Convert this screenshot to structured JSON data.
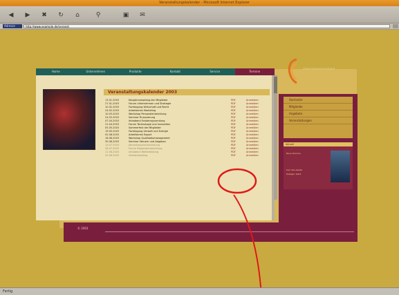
{
  "window": {
    "title": "Veranstaltungskalender - Microsoft Internet Explorer"
  },
  "toolbar": {
    "icons": [
      "back-icon",
      "forward-icon",
      "stop-icon",
      "refresh-icon",
      "home-icon",
      "search-icon",
      "print-icon",
      "mail-icon"
    ]
  },
  "address": {
    "label": "Adresse",
    "value": "http://www.example.de/veranst"
  },
  "nav": {
    "items": [
      "Home",
      "Unternehmen",
      "Produkte",
      "Kontakt",
      "Service",
      "Termine"
    ]
  },
  "content": {
    "heading": "Veranstaltungskalender 2003",
    "rows": [
      {
        "date": "13.01.2003",
        "name": "Neujahrsempfang der Mitglieder",
        "format": "PDF",
        "action": "Anmelden"
      },
      {
        "date": "27.01.2003",
        "name": "Forum Unternehmen und Strategie",
        "format": "PDF",
        "action": "Anmelden"
      },
      {
        "date": "10.02.2003",
        "name": "Fachtagung Wirtschaft und Recht",
        "format": "PDF",
        "action": "Anmelden"
      },
      {
        "date": "24.02.2003",
        "name": "Arbeitskreis Marketing",
        "format": "PDF",
        "action": "Anmelden"
      },
      {
        "date": "10.03.2003",
        "name": "Workshop Personalentwicklung",
        "format": "PDF",
        "action": "Anmelden"
      },
      {
        "date": "24.03.2003",
        "name": "Seminar Finanzierung",
        "format": "PDF",
        "action": "Anmelden"
      },
      {
        "date": "07.04.2003",
        "name": "Infoabend Existenzgruendung",
        "format": "PDF",
        "action": "Anmelden"
      },
      {
        "date": "21.04.2003",
        "name": "Forum Technologie und Innovation",
        "format": "PDF",
        "action": "Anmelden"
      },
      {
        "date": "05.05.2003",
        "name": "Sommerfest der Mitglieder",
        "format": "PDF",
        "action": "Anmelden"
      },
      {
        "date": "19.05.2003",
        "name": "Fachtagung Umwelt und Energie",
        "format": "PDF",
        "action": "Anmelden"
      },
      {
        "date": "02.06.2003",
        "name": "Arbeitskreis Export",
        "format": "PDF",
        "action": "Anmelden"
      },
      {
        "date": "16.06.2003",
        "name": "Workshop Qualitaetsmanagement",
        "format": "PDF",
        "action": "Anmelden"
      },
      {
        "date": "30.06.2003",
        "name": "Seminar Steuern und Abgaben",
        "format": "PDF",
        "action": "Anmelden"
      },
      {
        "date": "14.07.2003",
        "name": "Jahreshauptversammlung",
        "format": "PDF",
        "action": "Anmelden"
      },
      {
        "date": "28.07.2003",
        "name": "Forum Regionalentwicklung",
        "format": "PDF",
        "action": "Anmelden"
      },
      {
        "date": "11.08.2003",
        "name": "Infoabend Weiterbildung",
        "format": "PDF",
        "action": "Anmelden"
      },
      {
        "date": "25.08.2003",
        "name": "Herbstempfang",
        "format": "PDF",
        "action": "Anmelden"
      }
    ]
  },
  "logo": {
    "text": "Unternehmensverband"
  },
  "sidemenu": {
    "items": [
      "Startseite",
      "Mitglieder",
      "Angebote",
      "Veranstaltungen"
    ]
  },
  "news": {
    "header": "Aktuell",
    "line1": "Neue Termine",
    "line2": "fuer das zweite",
    "line3": "Halbjahr 2003"
  },
  "footer": {
    "label": "© 2003"
  },
  "statusbar": {
    "text": "Fertig"
  },
  "colors": {
    "accent": "#7a1e3e",
    "background": "#c9aa40",
    "nav": "#1f5f5a",
    "annotation": "#e01818"
  }
}
